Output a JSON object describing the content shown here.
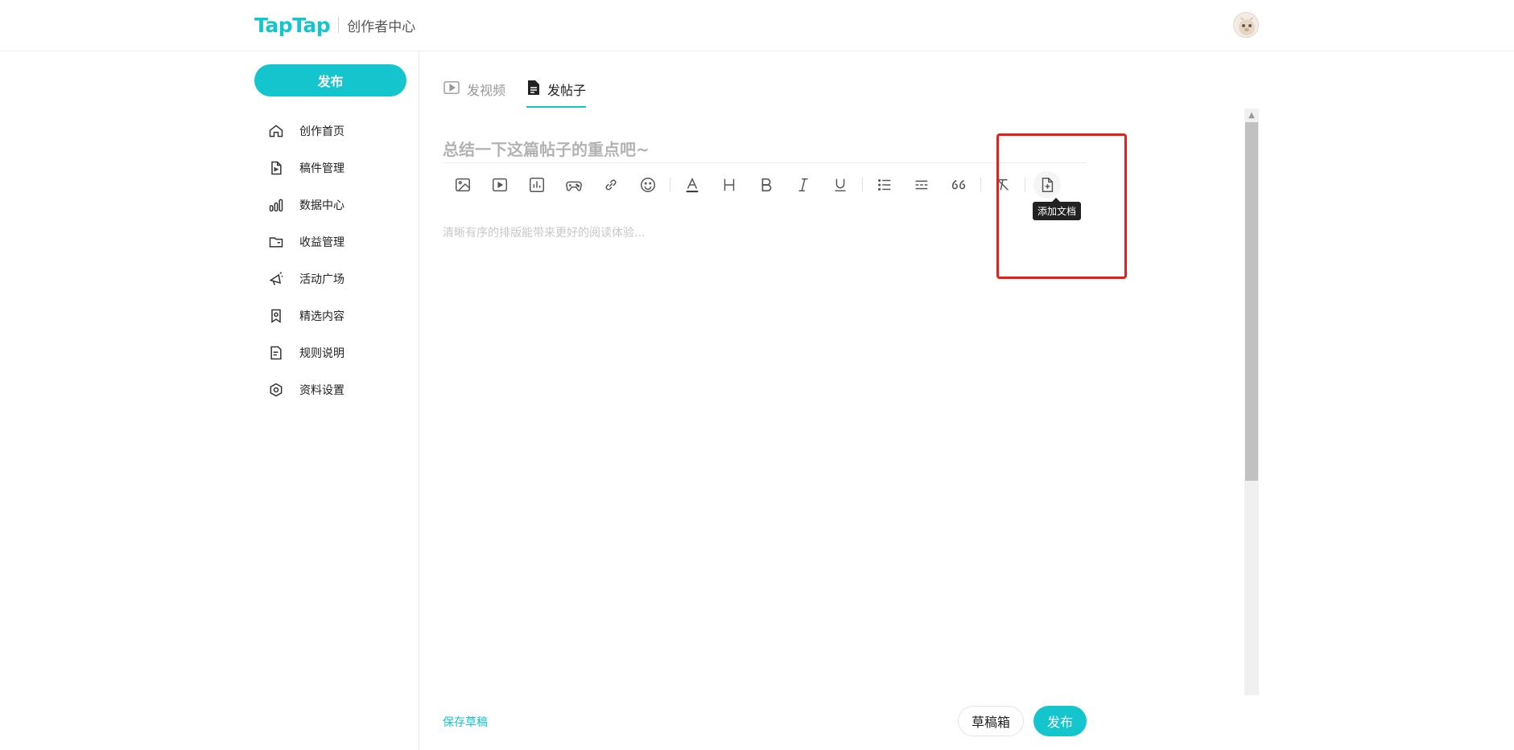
{
  "header": {
    "brand": "TapTap",
    "subtitle": "创作者中心"
  },
  "sidebar": {
    "publish_label": "发布",
    "items": [
      {
        "label": "创作首页",
        "icon": "home-icon"
      },
      {
        "label": "稿件管理",
        "icon": "document-icon"
      },
      {
        "label": "数据中心",
        "icon": "bar-chart-icon"
      },
      {
        "label": "收益管理",
        "icon": "folder-icon"
      },
      {
        "label": "活动广场",
        "icon": "megaphone-icon"
      },
      {
        "label": "精选内容",
        "icon": "bookmark-icon"
      },
      {
        "label": "规则说明",
        "icon": "rules-icon"
      },
      {
        "label": "资料设置",
        "icon": "settings-icon"
      }
    ]
  },
  "main": {
    "tabs": [
      {
        "label": "发视频",
        "icon": "video-icon"
      },
      {
        "label": "发帖子",
        "icon": "post-icon"
      }
    ],
    "title_placeholder": "总结一下这篇帖子的重点吧~",
    "content_placeholder": "清晰有序的排版能带来更好的阅读体验...",
    "toolbar": {
      "tooltip": "添加文档"
    },
    "footer": {
      "save_draft": "保存草稿",
      "drafts": "草稿箱",
      "publish": "发布"
    }
  },
  "colors": {
    "accent": "#15c5ce",
    "highlight": "#e3201b"
  }
}
